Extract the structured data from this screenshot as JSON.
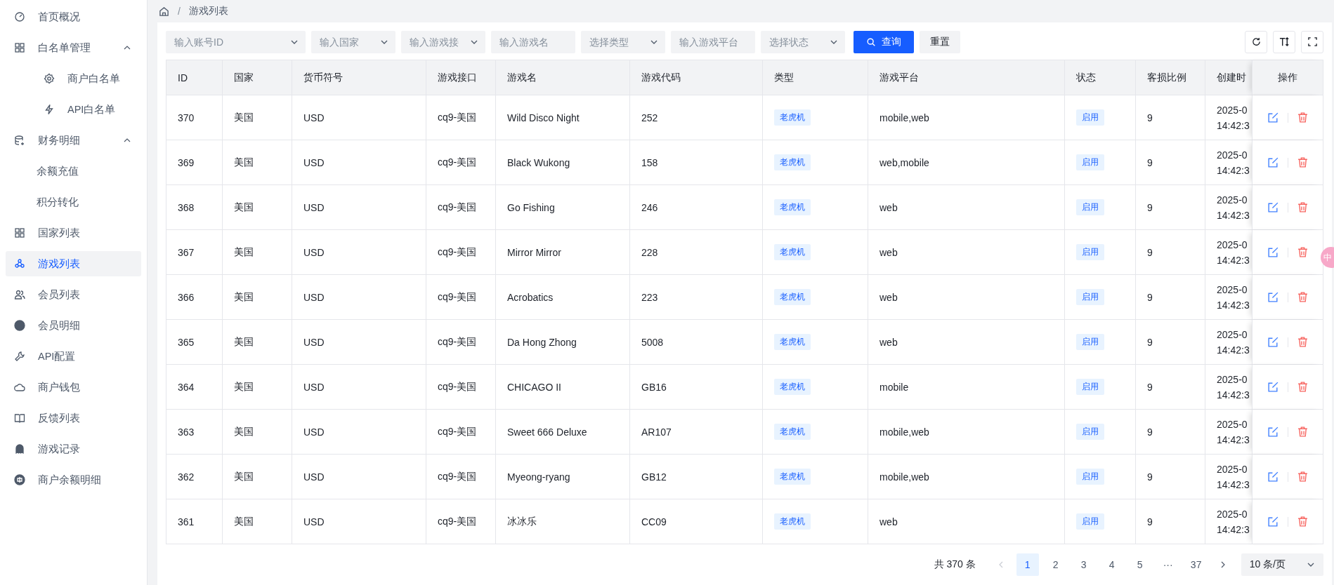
{
  "sidebar": {
    "items": [
      {
        "label": "首页概况",
        "selected": false
      },
      {
        "label": "白名单管理",
        "selected": false,
        "expanded": true,
        "children": [
          {
            "label": "商户白名单",
            "selected": false
          },
          {
            "label": "API白名单",
            "selected": false
          }
        ]
      },
      {
        "label": "财务明细",
        "selected": false,
        "expanded": true,
        "children": [
          {
            "label": "余额充值",
            "selected": false
          },
          {
            "label": "积分转化",
            "selected": false
          }
        ]
      },
      {
        "label": "国家列表",
        "selected": false
      },
      {
        "label": "游戏列表",
        "selected": true
      },
      {
        "label": "会员列表",
        "selected": false
      },
      {
        "label": "会员明细",
        "selected": false
      },
      {
        "label": "API配置",
        "selected": false
      },
      {
        "label": "商户钱包",
        "selected": false
      },
      {
        "label": "反馈列表",
        "selected": false
      },
      {
        "label": "游戏记录",
        "selected": false
      },
      {
        "label": "商户余额明细",
        "selected": false
      }
    ]
  },
  "breadcrumb": {
    "separator": "/",
    "current": "游戏列表"
  },
  "filters": [
    {
      "kind": "select",
      "placeholder": "输入账号ID"
    },
    {
      "kind": "select",
      "placeholder": "输入国家"
    },
    {
      "kind": "select",
      "placeholder": "输入游戏接"
    },
    {
      "kind": "input",
      "placeholder": "输入游戏名"
    },
    {
      "kind": "select",
      "placeholder": "选择类型"
    },
    {
      "kind": "input",
      "placeholder": "输入游戏平台"
    },
    {
      "kind": "select",
      "placeholder": "选择状态"
    }
  ],
  "buttons": [
    {
      "kind": "primary",
      "label": "查询"
    },
    {
      "kind": "plain",
      "label": "重置"
    }
  ],
  "table": {
    "columns": [
      {
        "label": "ID",
        "kind": "text"
      },
      {
        "label": "国家",
        "kind": "text"
      },
      {
        "label": "货币符号",
        "kind": "text"
      },
      {
        "label": "游戏接口",
        "kind": "text"
      },
      {
        "label": "游戏名",
        "kind": "text"
      },
      {
        "label": "游戏代码",
        "kind": "text"
      },
      {
        "label": "类型",
        "kind": "tag"
      },
      {
        "label": "游戏平台",
        "kind": "text"
      },
      {
        "label": "状态",
        "kind": "tag"
      },
      {
        "label": "客损比例",
        "kind": "text"
      },
      {
        "label": "创建时",
        "kind": "lines"
      },
      {
        "label": "操作",
        "kind": "actions"
      }
    ],
    "rows": [
      {
        "cells": [
          "370",
          "美国",
          "USD",
          "cq9-美国",
          "Wild Disco Night",
          "252",
          "老虎机",
          "mobile,web",
          "启用",
          "9",
          [
            "2025-0",
            "14:42:3"
          ]
        ]
      },
      {
        "cells": [
          "369",
          "美国",
          "USD",
          "cq9-美国",
          "Black Wukong",
          "158",
          "老虎机",
          "web,mobile",
          "启用",
          "9",
          [
            "2025-0",
            "14:42:3"
          ]
        ]
      },
      {
        "cells": [
          "368",
          "美国",
          "USD",
          "cq9-美国",
          "Go Fishing",
          "246",
          "老虎机",
          "web",
          "启用",
          "9",
          [
            "2025-0",
            "14:42:3"
          ]
        ]
      },
      {
        "cells": [
          "367",
          "美国",
          "USD",
          "cq9-美国",
          "Mirror Mirror",
          "228",
          "老虎机",
          "web",
          "启用",
          "9",
          [
            "2025-0",
            "14:42:3"
          ]
        ]
      },
      {
        "cells": [
          "366",
          "美国",
          "USD",
          "cq9-美国",
          "Acrobatics",
          "223",
          "老虎机",
          "web",
          "启用",
          "9",
          [
            "2025-0",
            "14:42:3"
          ]
        ]
      },
      {
        "cells": [
          "365",
          "美国",
          "USD",
          "cq9-美国",
          "Da Hong Zhong",
          "5008",
          "老虎机",
          "web",
          "启用",
          "9",
          [
            "2025-0",
            "14:42:3"
          ]
        ]
      },
      {
        "cells": [
          "364",
          "美国",
          "USD",
          "cq9-美国",
          "CHICAGO II",
          "GB16",
          "老虎机",
          "mobile",
          "启用",
          "9",
          [
            "2025-0",
            "14:42:3"
          ]
        ]
      },
      {
        "cells": [
          "363",
          "美国",
          "USD",
          "cq9-美国",
          "Sweet 666 Deluxe",
          "AR107",
          "老虎机",
          "mobile,web",
          "启用",
          "9",
          [
            "2025-0",
            "14:42:3"
          ]
        ]
      },
      {
        "cells": [
          "362",
          "美国",
          "USD",
          "cq9-美国",
          "Myeong-ryang",
          "GB12",
          "老虎机",
          "mobile,web",
          "启用",
          "9",
          [
            "2025-0",
            "14:42:3"
          ]
        ]
      },
      {
        "cells": [
          "361",
          "美国",
          "USD",
          "cq9-美国",
          "冰冰乐",
          "CC09",
          "老虎机",
          "web",
          "启用",
          "9",
          [
            "2025-0",
            "14:42:3"
          ]
        ]
      }
    ]
  },
  "pagination": {
    "total": "共 370 条",
    "pages": [
      {
        "label": "1",
        "selected": true
      },
      {
        "label": "2",
        "selected": false
      },
      {
        "label": "3",
        "selected": false
      },
      {
        "label": "4",
        "selected": false
      },
      {
        "label": "5",
        "selected": false
      },
      {
        "label": "···",
        "selected": false
      },
      {
        "label": "37",
        "selected": false
      }
    ],
    "page_size": "10 条/页"
  },
  "floating_badge": "中"
}
